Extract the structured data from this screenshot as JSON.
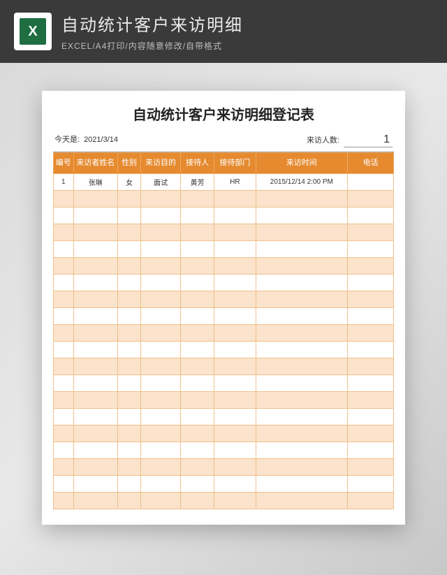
{
  "banner": {
    "title": "自动统计客户来访明细",
    "subtitle": "EXCEL/A4打印/内容随意修改/自带格式",
    "icon_letter": "X"
  },
  "sheet": {
    "title": "自动统计客户来访明细登记表",
    "today_label": "今天是:",
    "today_value": "2021/3/14",
    "visitor_count_label": "来访人数:",
    "visitor_count_value": "1"
  },
  "columns": {
    "no": "编号",
    "name": "来访者姓名",
    "gender": "性别",
    "purpose": "来访目的",
    "receiver": "接待人",
    "dept": "接待部门",
    "time": "来访时间",
    "phone": "电话"
  },
  "rows": [
    {
      "no": "1",
      "name": "张琳",
      "gender": "女",
      "purpose": "面试",
      "receiver": "黄芳",
      "dept": "HR",
      "time": "2015/12/14 2:00 PM",
      "phone": ""
    },
    {
      "no": "",
      "name": "",
      "gender": "",
      "purpose": "",
      "receiver": "",
      "dept": "",
      "time": "",
      "phone": ""
    },
    {
      "no": "",
      "name": "",
      "gender": "",
      "purpose": "",
      "receiver": "",
      "dept": "",
      "time": "",
      "phone": ""
    },
    {
      "no": "",
      "name": "",
      "gender": "",
      "purpose": "",
      "receiver": "",
      "dept": "",
      "time": "",
      "phone": ""
    },
    {
      "no": "",
      "name": "",
      "gender": "",
      "purpose": "",
      "receiver": "",
      "dept": "",
      "time": "",
      "phone": ""
    },
    {
      "no": "",
      "name": "",
      "gender": "",
      "purpose": "",
      "receiver": "",
      "dept": "",
      "time": "",
      "phone": ""
    },
    {
      "no": "",
      "name": "",
      "gender": "",
      "purpose": "",
      "receiver": "",
      "dept": "",
      "time": "",
      "phone": ""
    },
    {
      "no": "",
      "name": "",
      "gender": "",
      "purpose": "",
      "receiver": "",
      "dept": "",
      "time": "",
      "phone": ""
    },
    {
      "no": "",
      "name": "",
      "gender": "",
      "purpose": "",
      "receiver": "",
      "dept": "",
      "time": "",
      "phone": ""
    },
    {
      "no": "",
      "name": "",
      "gender": "",
      "purpose": "",
      "receiver": "",
      "dept": "",
      "time": "",
      "phone": ""
    },
    {
      "no": "",
      "name": "",
      "gender": "",
      "purpose": "",
      "receiver": "",
      "dept": "",
      "time": "",
      "phone": ""
    },
    {
      "no": "",
      "name": "",
      "gender": "",
      "purpose": "",
      "receiver": "",
      "dept": "",
      "time": "",
      "phone": ""
    },
    {
      "no": "",
      "name": "",
      "gender": "",
      "purpose": "",
      "receiver": "",
      "dept": "",
      "time": "",
      "phone": ""
    },
    {
      "no": "",
      "name": "",
      "gender": "",
      "purpose": "",
      "receiver": "",
      "dept": "",
      "time": "",
      "phone": ""
    },
    {
      "no": "",
      "name": "",
      "gender": "",
      "purpose": "",
      "receiver": "",
      "dept": "",
      "time": "",
      "phone": ""
    },
    {
      "no": "",
      "name": "",
      "gender": "",
      "purpose": "",
      "receiver": "",
      "dept": "",
      "time": "",
      "phone": ""
    },
    {
      "no": "",
      "name": "",
      "gender": "",
      "purpose": "",
      "receiver": "",
      "dept": "",
      "time": "",
      "phone": ""
    },
    {
      "no": "",
      "name": "",
      "gender": "",
      "purpose": "",
      "receiver": "",
      "dept": "",
      "time": "",
      "phone": ""
    },
    {
      "no": "",
      "name": "",
      "gender": "",
      "purpose": "",
      "receiver": "",
      "dept": "",
      "time": "",
      "phone": ""
    },
    {
      "no": "",
      "name": "",
      "gender": "",
      "purpose": "",
      "receiver": "",
      "dept": "",
      "time": "",
      "phone": ""
    }
  ]
}
